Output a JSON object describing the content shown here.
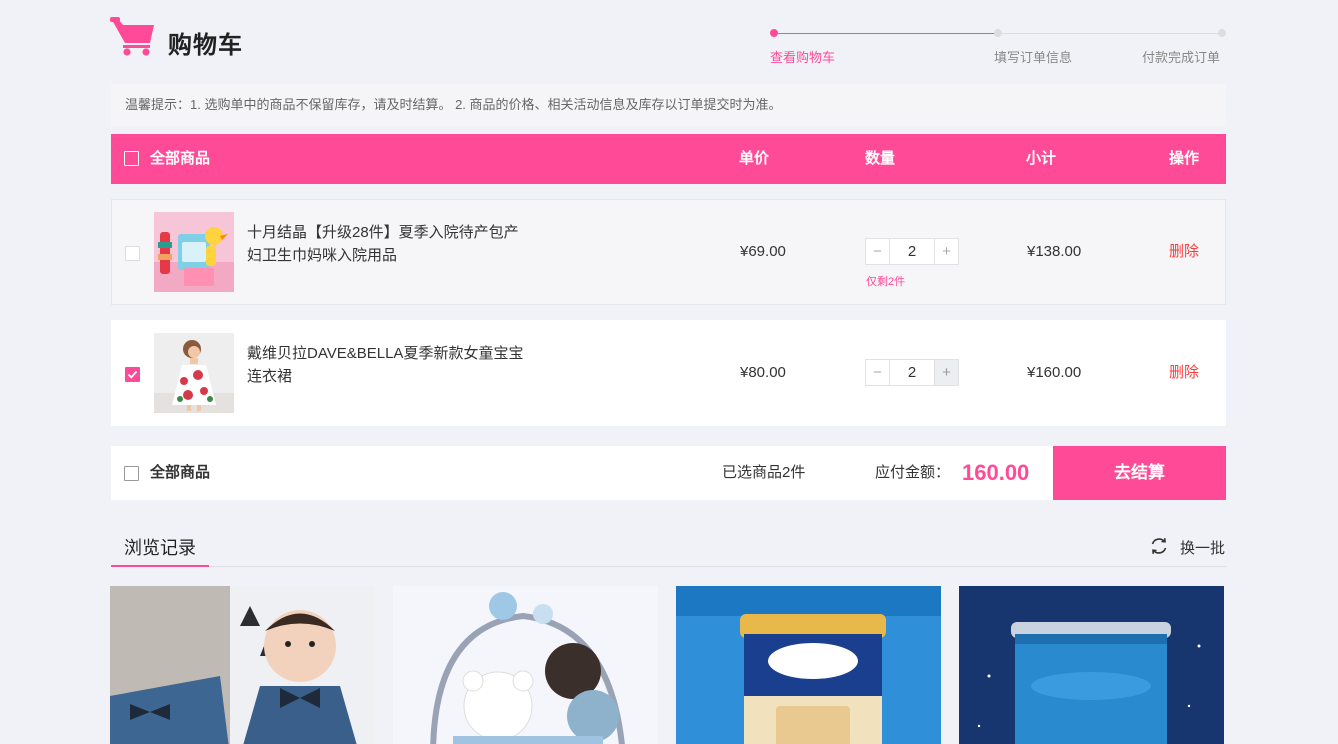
{
  "header": {
    "title": "购物车",
    "steps": [
      "查看购物车",
      "填写订单信息",
      "付款完成订单"
    ],
    "active_step": 0
  },
  "tip": "温馨提示：1. 选购单中的商品不保留库存，请及时结算。 2. 商品的价格、相关活动信息及库存以订单提交时为准。",
  "table": {
    "select_all": "全部商品",
    "col_price": "单价",
    "col_qty": "数量",
    "col_subtotal": "小计",
    "col_action": "操作"
  },
  "items": [
    {
      "name": "十月结晶【升级28件】夏季入院待产包产妇卫生巾妈咪入院用品",
      "price": "¥69.00",
      "qty": "2",
      "stock_note": "仅剩2件",
      "subtotal": "¥138.00",
      "action": "删除",
      "checked": false
    },
    {
      "name": "戴维贝拉DAVE&BELLA夏季新款女童宝宝连衣裙",
      "price": "¥80.00",
      "qty": "2",
      "subtotal": "¥160.00",
      "action": "删除",
      "checked": true
    }
  ],
  "qty_minus": "−",
  "qty_plus": "+",
  "footer": {
    "select_all": "全部商品",
    "selected": "已选商品2件",
    "payable_label": "应付金额：",
    "payable_amount": "160.00",
    "checkout": "去结算"
  },
  "history": {
    "title": "浏览记录",
    "refresh": "换一批"
  },
  "colors": {
    "accent": "#ff4b97",
    "delete": "#ff3b3b"
  }
}
